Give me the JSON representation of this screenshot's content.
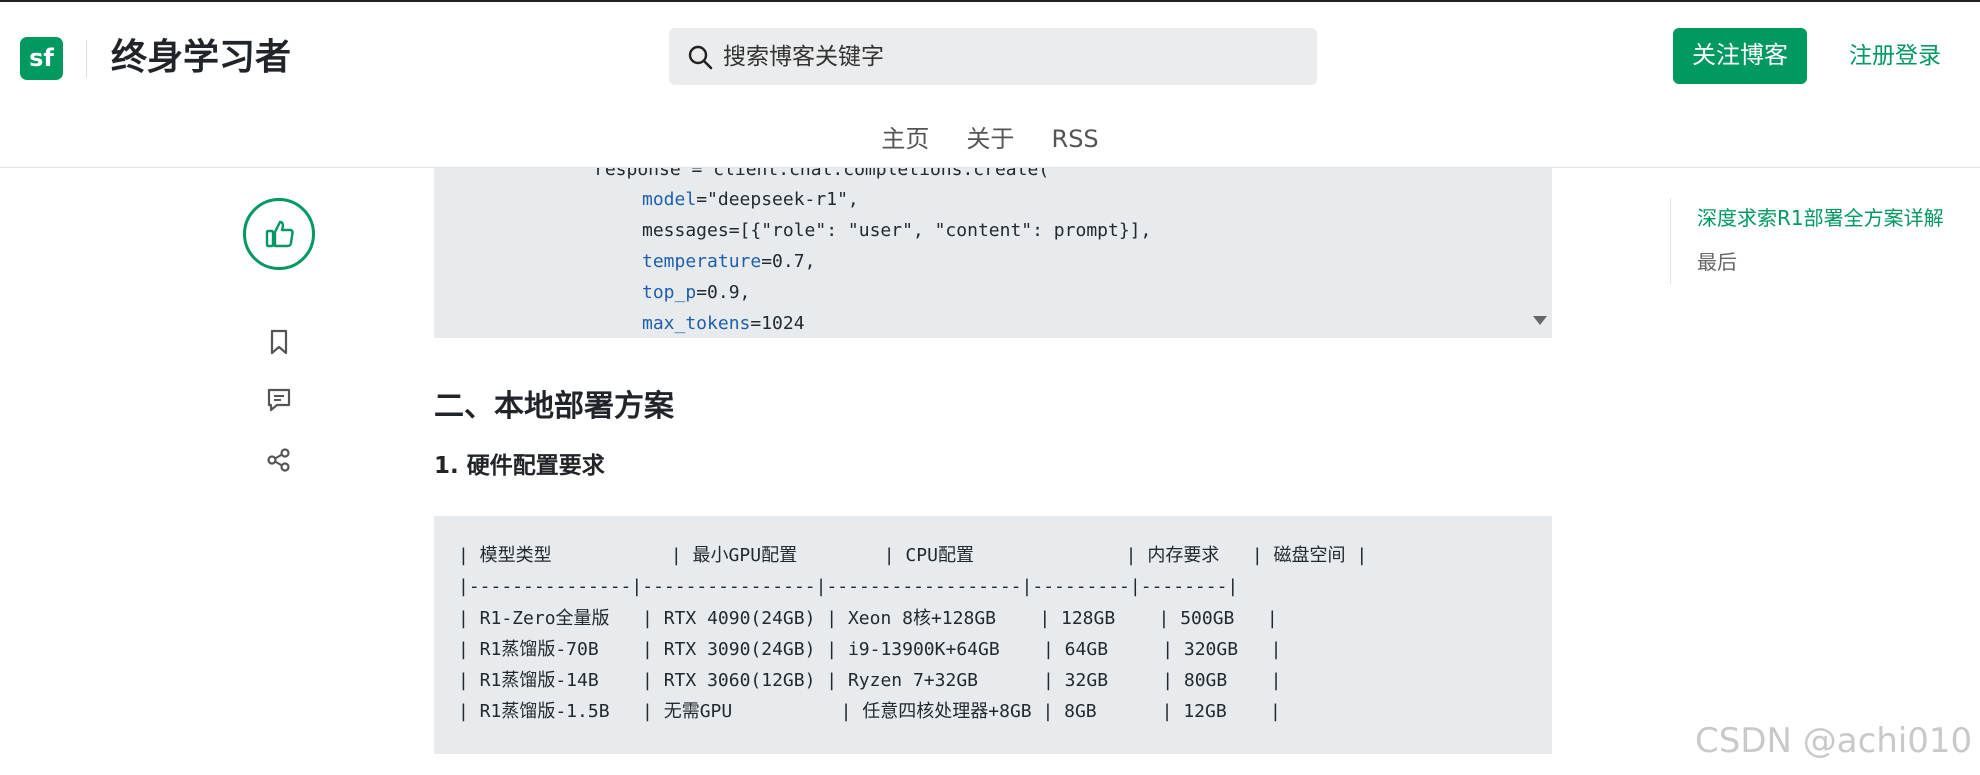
{
  "header": {
    "logo_text": "sf",
    "site_title": "终身学习者",
    "search_placeholder": "搜索博客关键字",
    "follow_label": "关注博客",
    "login_label": "注册登录",
    "brand_color": "#009a61"
  },
  "nav": {
    "items": [
      {
        "label": "主页"
      },
      {
        "label": "关于"
      },
      {
        "label": "RSS"
      }
    ]
  },
  "rail": {
    "like_icon": "thumbs-up-icon",
    "bookmark_icon": "bookmark-icon",
    "comment_icon": "comment-icon",
    "share_icon": "share-icon"
  },
  "code": {
    "lines": [
      {
        "indent": "            ",
        "text": "response = client.chat.completions.create("
      },
      {
        "indent": "                ",
        "param": "model",
        "rest": "=\"deepseek-r1\","
      },
      {
        "indent": "                ",
        "text": "messages=[{\"role\": \"user\", \"content\": prompt}],"
      },
      {
        "indent": "                ",
        "param": "temperature",
        "rest": "=0.7,"
      },
      {
        "indent": "                ",
        "param": "top_p",
        "rest": "=0.9,"
      },
      {
        "indent": "                ",
        "param": "max_tokens",
        "rest": "=1024"
      }
    ]
  },
  "article": {
    "h2": "二、本地部署方案",
    "h3": "1. 硬件配置要求"
  },
  "table_block": {
    "lines": [
      "| 模型类型           | 最小GPU配置        | CPU配置              | 内存要求   | 磁盘空间 |",
      "|---------------|----------------|------------------|---------|--------|",
      "| R1-Zero全量版   | RTX 4090(24GB) | Xeon 8核+128GB    | 128GB    | 500GB   |",
      "| R1蒸馏版-70B    | RTX 3090(24GB) | i9-13900K+64GB    | 64GB     | 320GB   |",
      "| R1蒸馏版-14B    | RTX 3060(12GB) | Ryzen 7+32GB      | 32GB     | 80GB    |",
      "| R1蒸馏版-1.5B   | 无需GPU          | 任意四核处理器+8GB | 8GB      | 12GB    |"
    ]
  },
  "toc": {
    "active": "深度求索R1部署全方案详解",
    "sub": "最后"
  },
  "watermark": "CSDN @achi010"
}
